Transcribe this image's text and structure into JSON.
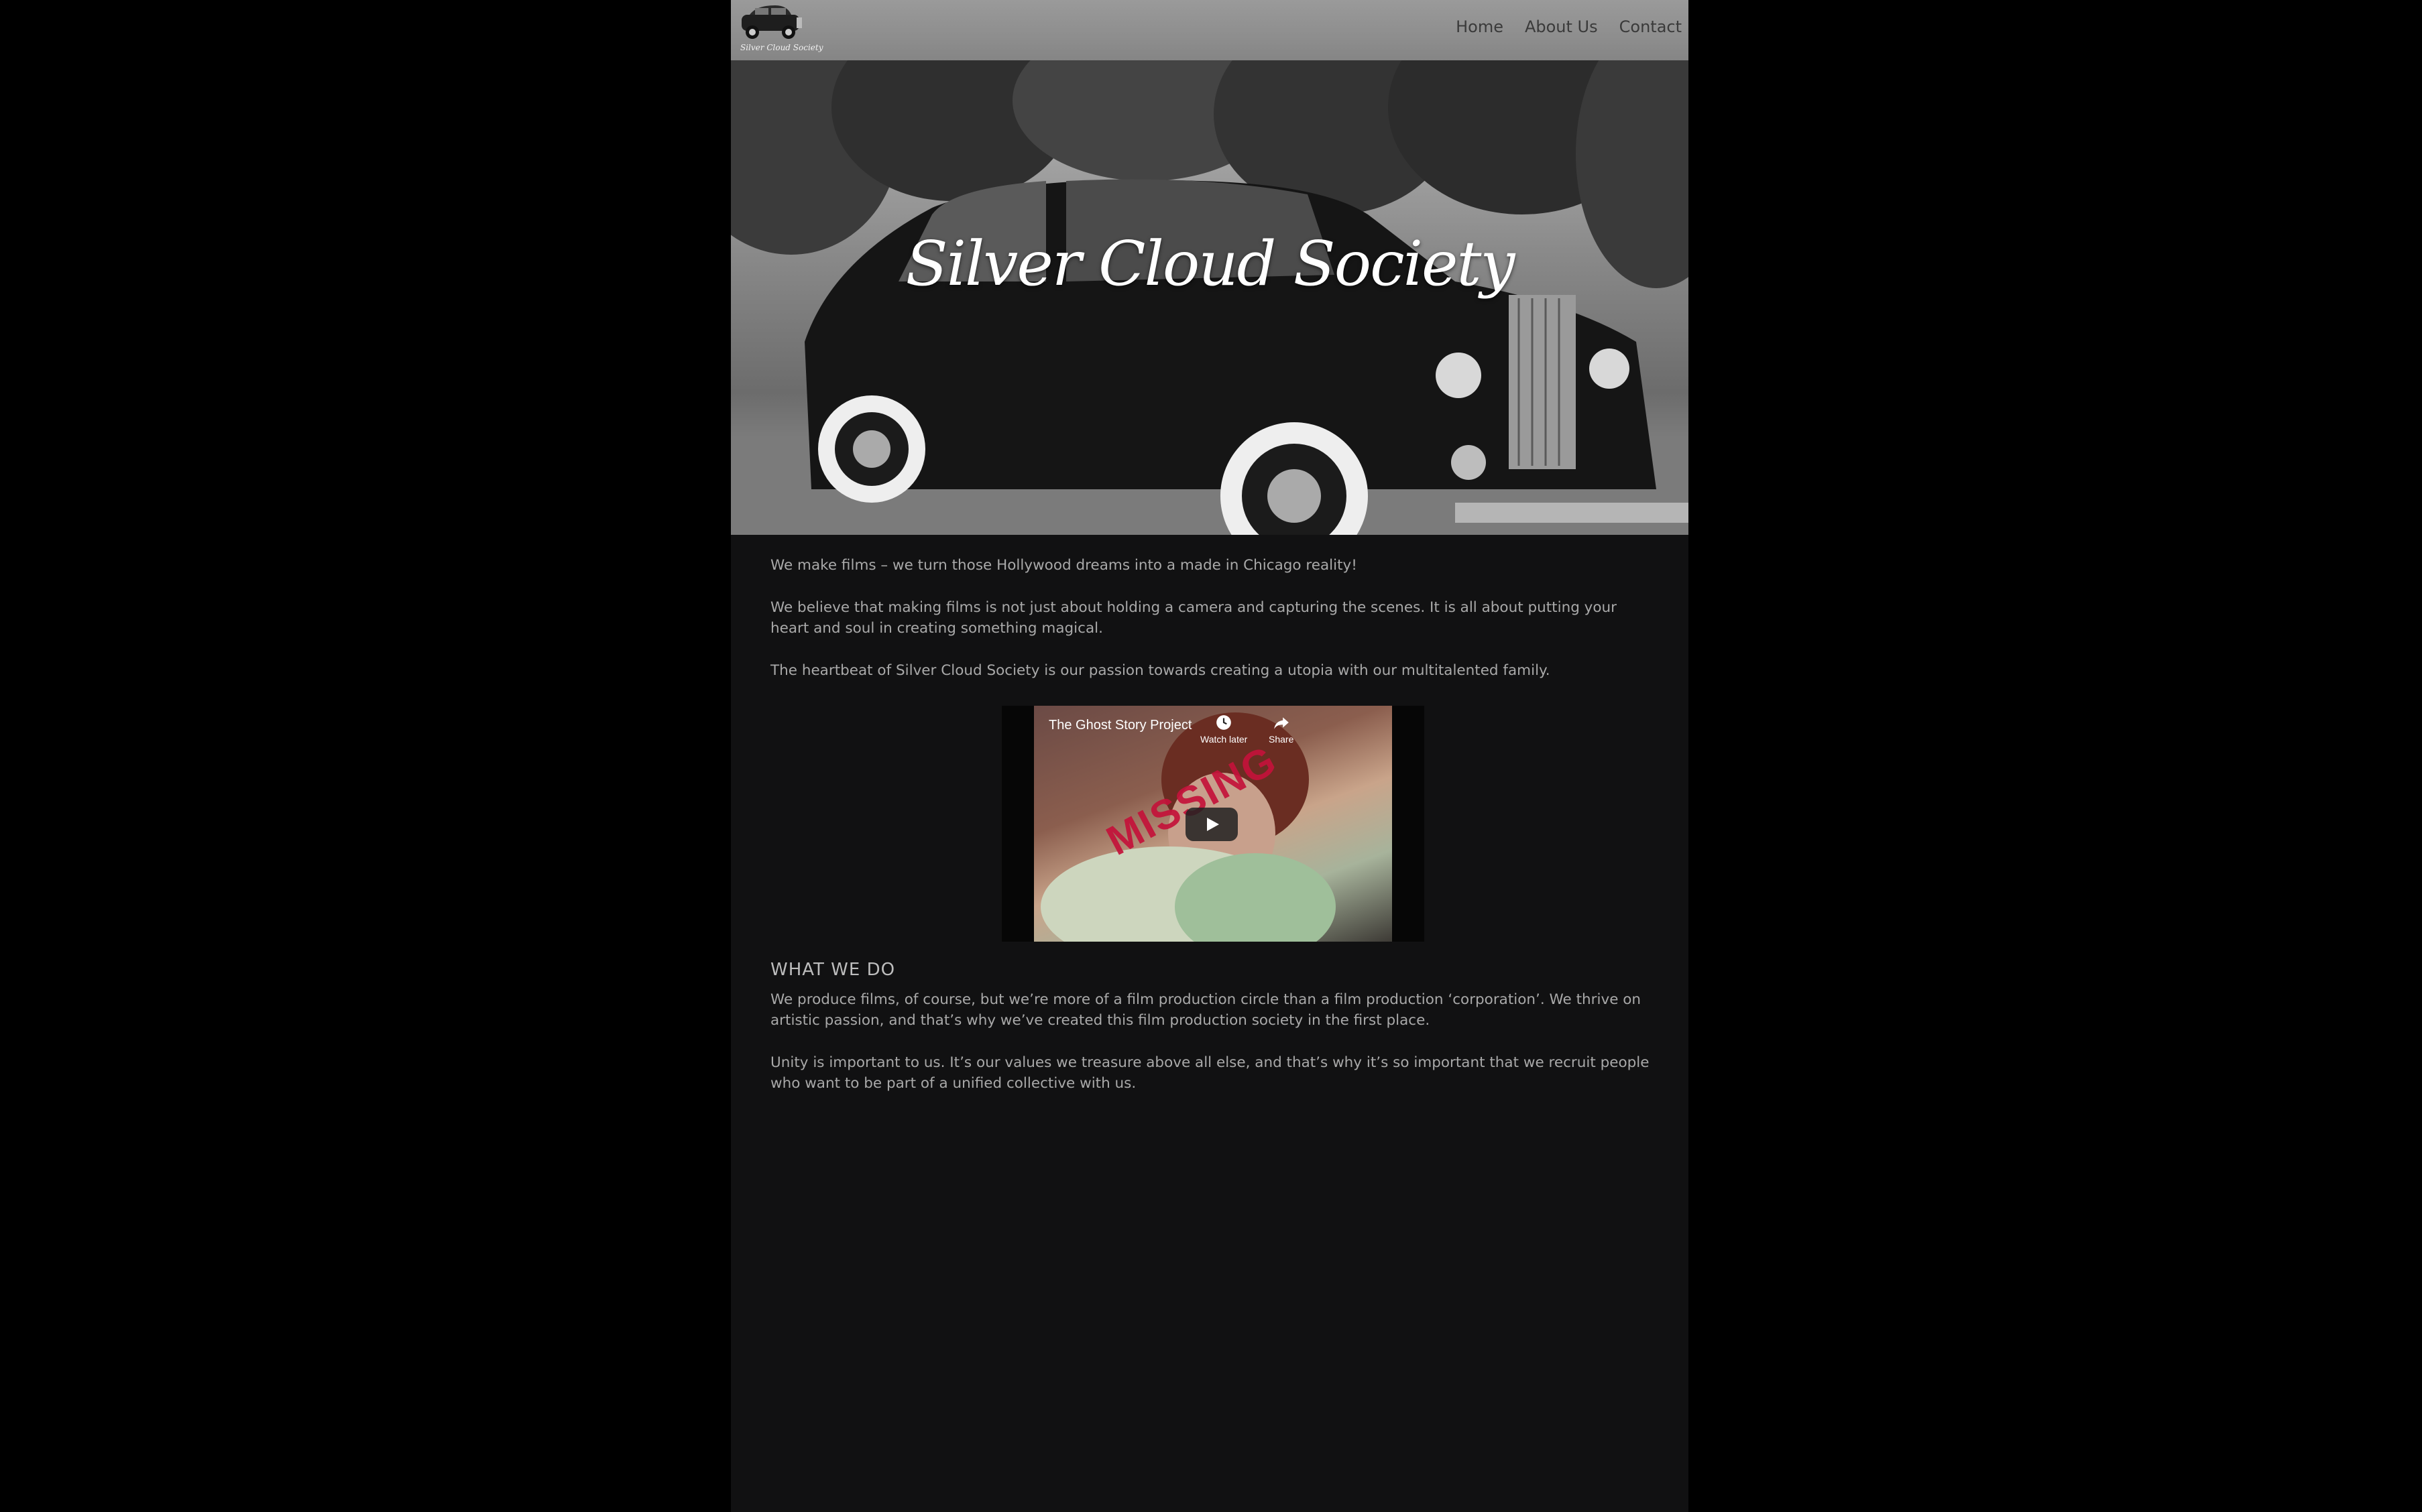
{
  "site": {
    "logo_text": "Silver Cloud Society",
    "hero_title": "Silver Cloud Society"
  },
  "nav": {
    "items": [
      {
        "label": "Home"
      },
      {
        "label": "About Us"
      },
      {
        "label": "Contact"
      }
    ]
  },
  "intro": {
    "p1": "We make films – we turn those Hollywood dreams into a made in Chicago reality!",
    "p2": "We believe that making films is not just about holding a camera and capturing the scenes. It is all about putting your heart and soul in creating something magical.",
    "p3": "The heartbeat of Silver Cloud Society is our passion towards creating a utopia with our multitalented family."
  },
  "video": {
    "title": "The Ghost Story Project",
    "watch_later": "Watch later",
    "share": "Share",
    "overlay_text": "MISSING",
    "icons": [
      "clock-icon",
      "share-icon",
      "play-icon"
    ]
  },
  "what_we_do": {
    "heading": "WHAT WE DO",
    "p1": "We produce films, of course, but we’re more of a film production circle than a film production ‘corporation’. We thrive on artistic passion, and that’s why we’ve created this film production society in the first place.",
    "p2": "Unity is important to us. It’s our values we treasure above all else, and that’s why it’s so important that we recruit people who want to be part of a unified collective with us."
  },
  "colors": {
    "page_background": "#000000",
    "content_background": "#111112",
    "body_text": "#a9a9a9",
    "header_bar": "#8e8e8e",
    "nav_text": "#3a3a3a",
    "overlay_red": "#c4123a"
  }
}
